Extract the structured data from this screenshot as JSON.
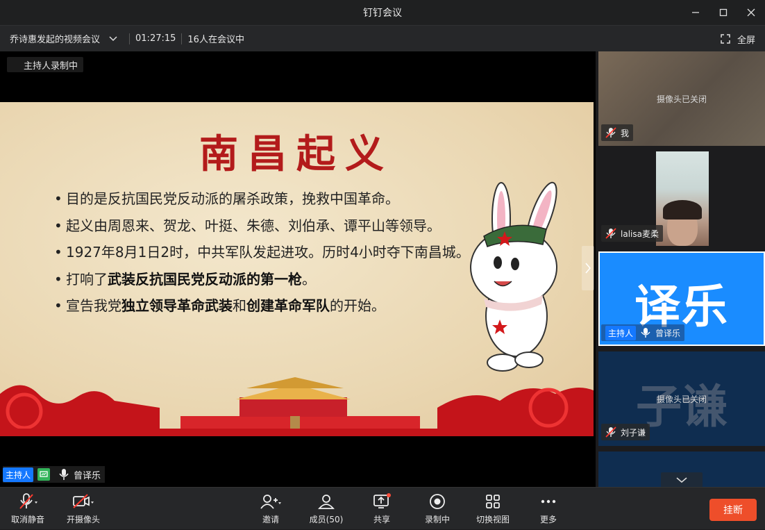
{
  "window": {
    "title": "钉钉会议"
  },
  "infobar": {
    "meeting_name": "乔诗惠发起的视频会议",
    "duration": "01:27:15",
    "participants": "16人在会议中",
    "fullscreen_label": "全屏"
  },
  "main": {
    "recording_badge": "主持人录制中",
    "slide": {
      "title": "南昌起义",
      "bullets": [
        {
          "parts": [
            {
              "text": "目的是反抗国民党反动派的屠杀政策，挽救中国革命。",
              "bold": false
            }
          ]
        },
        {
          "parts": [
            {
              "text": "起义由周恩来、贺龙、叶挺、朱德、刘伯承、谭平山等领导。",
              "bold": false
            }
          ]
        },
        {
          "parts": [
            {
              "text": "1927年8月1日2时，中共军队发起进攻。历时4小时夺下南昌城。",
              "bold": false
            }
          ]
        },
        {
          "parts": [
            {
              "text": "打响了",
              "bold": false
            },
            {
              "text": "武装反抗国民党反动派的第一枪",
              "bold": true
            },
            {
              "text": "。",
              "bold": false
            }
          ]
        },
        {
          "parts": [
            {
              "text": "宣告我党",
              "bold": false
            },
            {
              "text": "独立领导革命武装",
              "bold": true
            },
            {
              "text": "和",
              "bold": false
            },
            {
              "text": "创建革命军队",
              "bold": true
            },
            {
              "text": "的开始。",
              "bold": false
            }
          ]
        }
      ]
    },
    "speaker": {
      "host_tag": "主持人",
      "name": "曾译乐"
    }
  },
  "sidebar": {
    "tiles": [
      {
        "name": "我",
        "status": "摄像头已关闭",
        "muted": true
      },
      {
        "name": "lalisa麦柔",
        "muted": true
      },
      {
        "name": "曾译乐",
        "avatar_text": "译乐",
        "host_tag": "主持人",
        "muted": false
      },
      {
        "name": "刘子谦",
        "avatar_text": "子谦",
        "status": "摄像头已关闭",
        "muted": true
      }
    ]
  },
  "toolbar": {
    "unmute": "取消静音",
    "camera": "开摄像头",
    "invite": "邀请",
    "members": "成员(50)",
    "share": "共享",
    "recording": "录制中",
    "switch_view": "切换视图",
    "more": "更多",
    "hangup": "挂断"
  },
  "colors": {
    "accent": "#1478ff",
    "hangup": "#ee4e2a",
    "slide_title": "#b31b1b",
    "share_dot": "#ff4d3a"
  }
}
